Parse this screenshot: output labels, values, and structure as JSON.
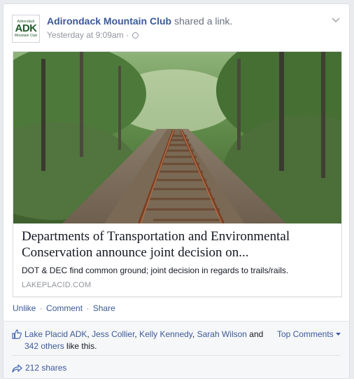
{
  "post": {
    "author": "Adirondack Mountain Club",
    "action": "shared a link.",
    "timestamp": "Yesterday at 9:09am",
    "separator": "·",
    "avatar": {
      "line1": "Adirondack",
      "line2": "ADK",
      "line3": "Mountain Club"
    }
  },
  "link": {
    "title": "Departments of Transportation and Environmental Conservation announce joint decision on...",
    "description": "DOT & DEC find common ground; joint decision in regards to trails/rails.",
    "domain": "LAKEPLACID.COM"
  },
  "actions": {
    "unlike": "Unlike",
    "comment": "Comment",
    "share": "Share",
    "separator": "·"
  },
  "likes": {
    "names": [
      "Lake Placid ADK",
      "Jess Collier",
      "Kelly Kennedy",
      "Sarah Wilson"
    ],
    "comma": ", ",
    "and": " and ",
    "others": "342 others",
    "suffix": " like this.",
    "top_comments": "Top Comments"
  },
  "shares": {
    "label": "212 shares"
  },
  "colors": {
    "link": "#3b5998",
    "meta": "#90949c",
    "background": "#e9ebee"
  },
  "icons": [
    "chevron-down-icon",
    "globe-icon",
    "like-icon",
    "share-icon",
    "dropdown-caret-icon"
  ]
}
